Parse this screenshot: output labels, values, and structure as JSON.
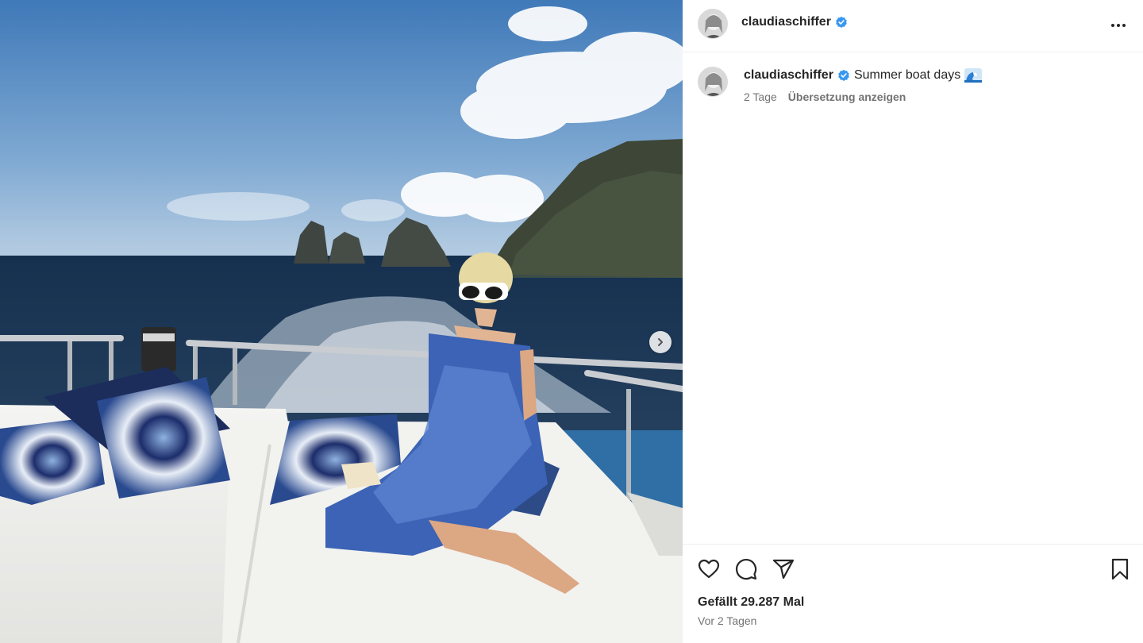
{
  "post": {
    "image_description_icon": "photo-icon",
    "carousel_next_icon": "chevron-right-icon"
  },
  "header": {
    "username": "claudiaschiffer",
    "verified_icon": "verified-badge-icon",
    "more_icon": "more-horizontal-icon"
  },
  "caption": {
    "username": "claudiaschiffer",
    "text": "Summer boat days",
    "emoji_icon": "wave-emoji-icon",
    "age": "2 Tage",
    "translate_label": "Übersetzung anzeigen"
  },
  "actions": {
    "like_icon": "heart-icon",
    "comment_icon": "comment-icon",
    "share_icon": "paper-plane-icon",
    "save_icon": "bookmark-icon",
    "likes_text": "Gefällt 29.287 Mal",
    "posted_text": "Vor 2 Tagen"
  },
  "colors": {
    "verified": "#3897f0",
    "text_primary": "#262626",
    "text_secondary": "#737373",
    "divider": "#efefef"
  }
}
